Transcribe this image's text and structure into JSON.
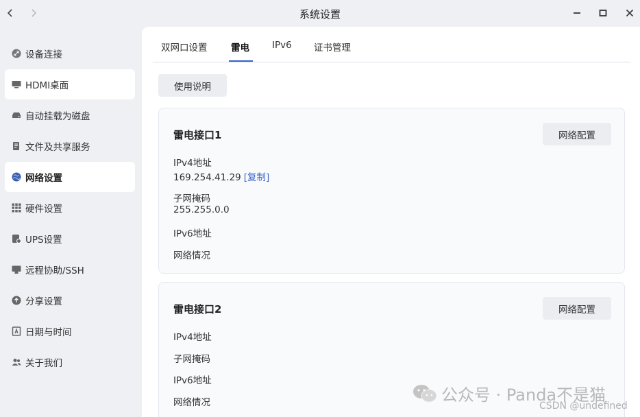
{
  "window": {
    "title": "系统设置"
  },
  "sidebar": {
    "items": [
      {
        "label": "设备连接",
        "icon": "link-icon"
      },
      {
        "label": "HDMI桌面",
        "icon": "monitor-icon"
      },
      {
        "label": "自动挂载为磁盘",
        "icon": "disk-icon"
      },
      {
        "label": "文件及共享服务",
        "icon": "file-share-icon"
      },
      {
        "label": "网络设置",
        "icon": "globe-icon",
        "active": true
      },
      {
        "label": "硬件设置",
        "icon": "grid-icon"
      },
      {
        "label": "UPS设置",
        "icon": "ups-icon"
      },
      {
        "label": "远程协助/SSH",
        "icon": "remote-icon"
      },
      {
        "label": "分享设置",
        "icon": "share-icon"
      },
      {
        "label": "日期与时间",
        "icon": "calendar-icon"
      },
      {
        "label": "关于我们",
        "icon": "users-icon"
      }
    ]
  },
  "tabs": [
    {
      "label": "双网口设置"
    },
    {
      "label": "雷电",
      "active": true
    },
    {
      "label": "IPv6"
    },
    {
      "label": "证书管理"
    }
  ],
  "help_button": "使用说明",
  "cards": [
    {
      "title": "雷电接口1",
      "config_button": "网络配置",
      "ipv4_label": "IPv4地址",
      "ipv4_value": "169.254.41.29",
      "copy_label": "[复制]",
      "mask_label": "子网掩码",
      "mask_value": "255.255.0.0",
      "ipv6_label": "IPv6地址",
      "status_label": "网络情况"
    },
    {
      "title": "雷电接口2",
      "config_button": "网络配置",
      "ipv4_label": "IPv4地址",
      "mask_label": "子网掩码",
      "ipv6_label": "IPv6地址",
      "status_label": "网络情况"
    }
  ],
  "watermark": {
    "text": "公众号 · Panda不是猫",
    "credit": "CSDN @undefined"
  },
  "colors": {
    "accent": "#3461c8",
    "background": "#eef0f4",
    "card_background": "#f9fafc",
    "button_background": "#ebedf1"
  }
}
